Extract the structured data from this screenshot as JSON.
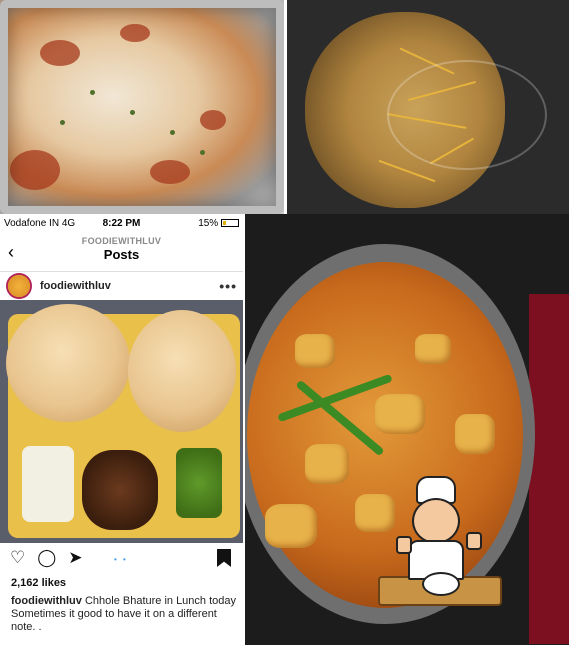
{
  "collage": {
    "insta": {
      "status": {
        "carrier": "Vodafone IN",
        "network": "4G",
        "time": "8:22 PM",
        "battery": "15%"
      },
      "nav": {
        "back_glyph": "‹",
        "overline": "FOODIEWITHLUV",
        "title": "Posts"
      },
      "user": {
        "name": "foodiewithluv",
        "more_glyph": "•••"
      },
      "actions": {
        "like_glyph": "♡",
        "comment_glyph": "◯",
        "share_glyph": "➤",
        "pager_glyph": "• •"
      },
      "likes": "2,162 likes",
      "caption": {
        "author": "foodiewithluv",
        "text": "Chhole Bhature in Lunch today",
        "line2": "Sometimes it good to have it on a different note. ."
      }
    },
    "icons": {
      "back": "back-chevron-icon",
      "more": "more-dots-icon",
      "like": "heart-icon",
      "comment": "comment-icon",
      "share": "send-icon",
      "save": "bookmark-icon",
      "chef": "chef-thumbs-up-icon"
    },
    "colors": {
      "link_blue": "#3897f0",
      "instagram_avatar_ring": "#b01f5a",
      "battery": "#e0b000"
    }
  }
}
